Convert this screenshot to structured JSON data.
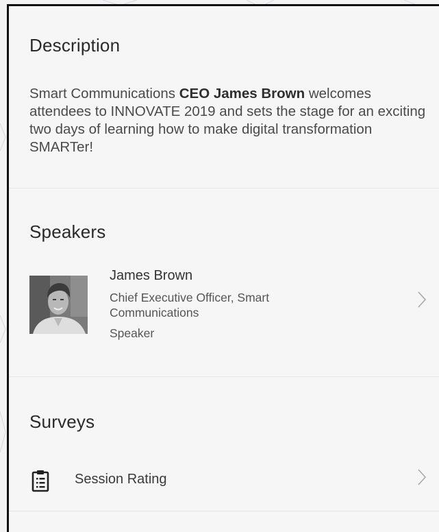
{
  "description": {
    "title": "Description",
    "text_before": "Smart Communications ",
    "text_bold": "CEO James Brown",
    "text_after": " welcomes attendees to INNOVATE 2019 and sets the stage for an exciting two days of learning how to make digital transformation SMARTer!"
  },
  "speakers": {
    "title": "Speakers",
    "items": [
      {
        "name": "James Brown",
        "role": "Chief Executive Officer, Smart Communications",
        "tag": "Speaker",
        "chevron": "chevron-right-icon"
      }
    ]
  },
  "surveys": {
    "title": "Surveys",
    "items": [
      {
        "label": "Session Rating",
        "icon": "clipboard-icon",
        "chevron": "chevron-right-icon"
      }
    ]
  },
  "colors": {
    "background": "#f6f6f6",
    "divider": "#e6e6e6",
    "text_primary": "#2a2a2a",
    "text_secondary": "#555555",
    "chevron": "#a8a8a8"
  }
}
